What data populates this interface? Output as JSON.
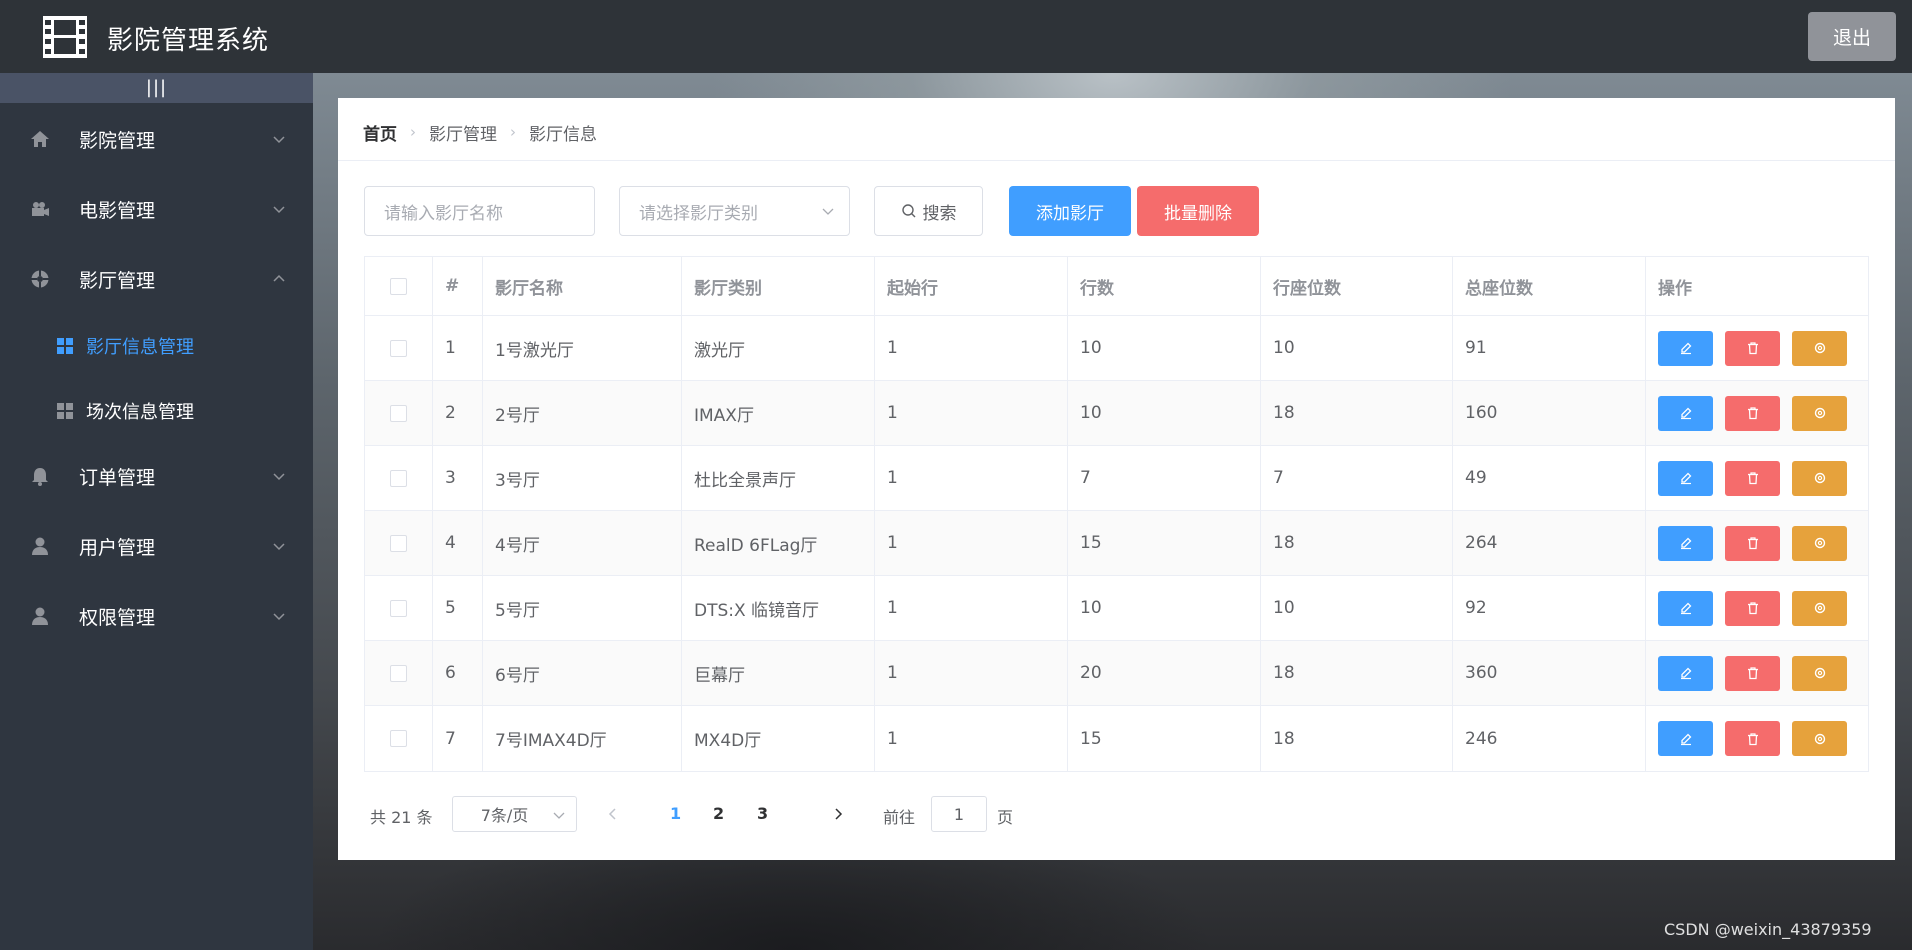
{
  "header": {
    "title": "影院管理系统",
    "logout_label": "退出"
  },
  "sidebar": {
    "collapse_label": "|||",
    "items": [
      {
        "label": "影院管理",
        "icon": "home-icon"
      },
      {
        "label": "电影管理",
        "icon": "camera-icon"
      },
      {
        "label": "影厅管理",
        "icon": "aperture-icon",
        "expanded": true
      },
      {
        "label": "订单管理",
        "icon": "bell-icon"
      },
      {
        "label": "用户管理",
        "icon": "user-icon"
      },
      {
        "label": "权限管理",
        "icon": "user-icon"
      }
    ],
    "sub_items": [
      {
        "label": "影厅信息管理",
        "active": true
      },
      {
        "label": "场次信息管理",
        "active": false
      }
    ]
  },
  "breadcrumb": [
    "首页",
    "影厅管理",
    "影厅信息"
  ],
  "toolbar": {
    "name_placeholder": "请输入影厅名称",
    "type_placeholder": "请选择影厅类别",
    "search_label": "搜索",
    "add_label": "添加影厅",
    "batch_delete_label": "批量删除"
  },
  "table": {
    "columns": [
      "#",
      "影厅名称",
      "影厅类别",
      "起始行",
      "行数",
      "行座位数",
      "总座位数",
      "操作"
    ],
    "rows": [
      [
        "1",
        "1号激光厅",
        "激光厅",
        "1",
        "10",
        "10",
        "91"
      ],
      [
        "2",
        "2号厅",
        "IMAX厅",
        "1",
        "10",
        "18",
        "160"
      ],
      [
        "3",
        "3号厅",
        "杜比全景声厅",
        "1",
        "7",
        "7",
        "49"
      ],
      [
        "4",
        "4号厅",
        "RealD 6FLag厅",
        "1",
        "15",
        "18",
        "264"
      ],
      [
        "5",
        "5号厅",
        "DTS:X 临镜音厅",
        "1",
        "10",
        "10",
        "92"
      ],
      [
        "6",
        "6号厅",
        "巨幕厅",
        "1",
        "20",
        "18",
        "360"
      ],
      [
        "7",
        "7号IMAX4D厅",
        "MX4D厅",
        "1",
        "15",
        "18",
        "246"
      ]
    ]
  },
  "pagination": {
    "total_label": "共 21 条",
    "page_size": "7条/页",
    "pages": [
      "1",
      "2",
      "3"
    ],
    "current": "1",
    "goto_label": "前往",
    "goto_value": "1",
    "page_suffix": "页"
  },
  "watermark": "CSDN @weixin_43879359",
  "colors": {
    "primary": "#409eff",
    "danger": "#f56c6c",
    "warning": "#e6a23c",
    "sidebar": "#2f3640",
    "header": "#2e3338"
  }
}
